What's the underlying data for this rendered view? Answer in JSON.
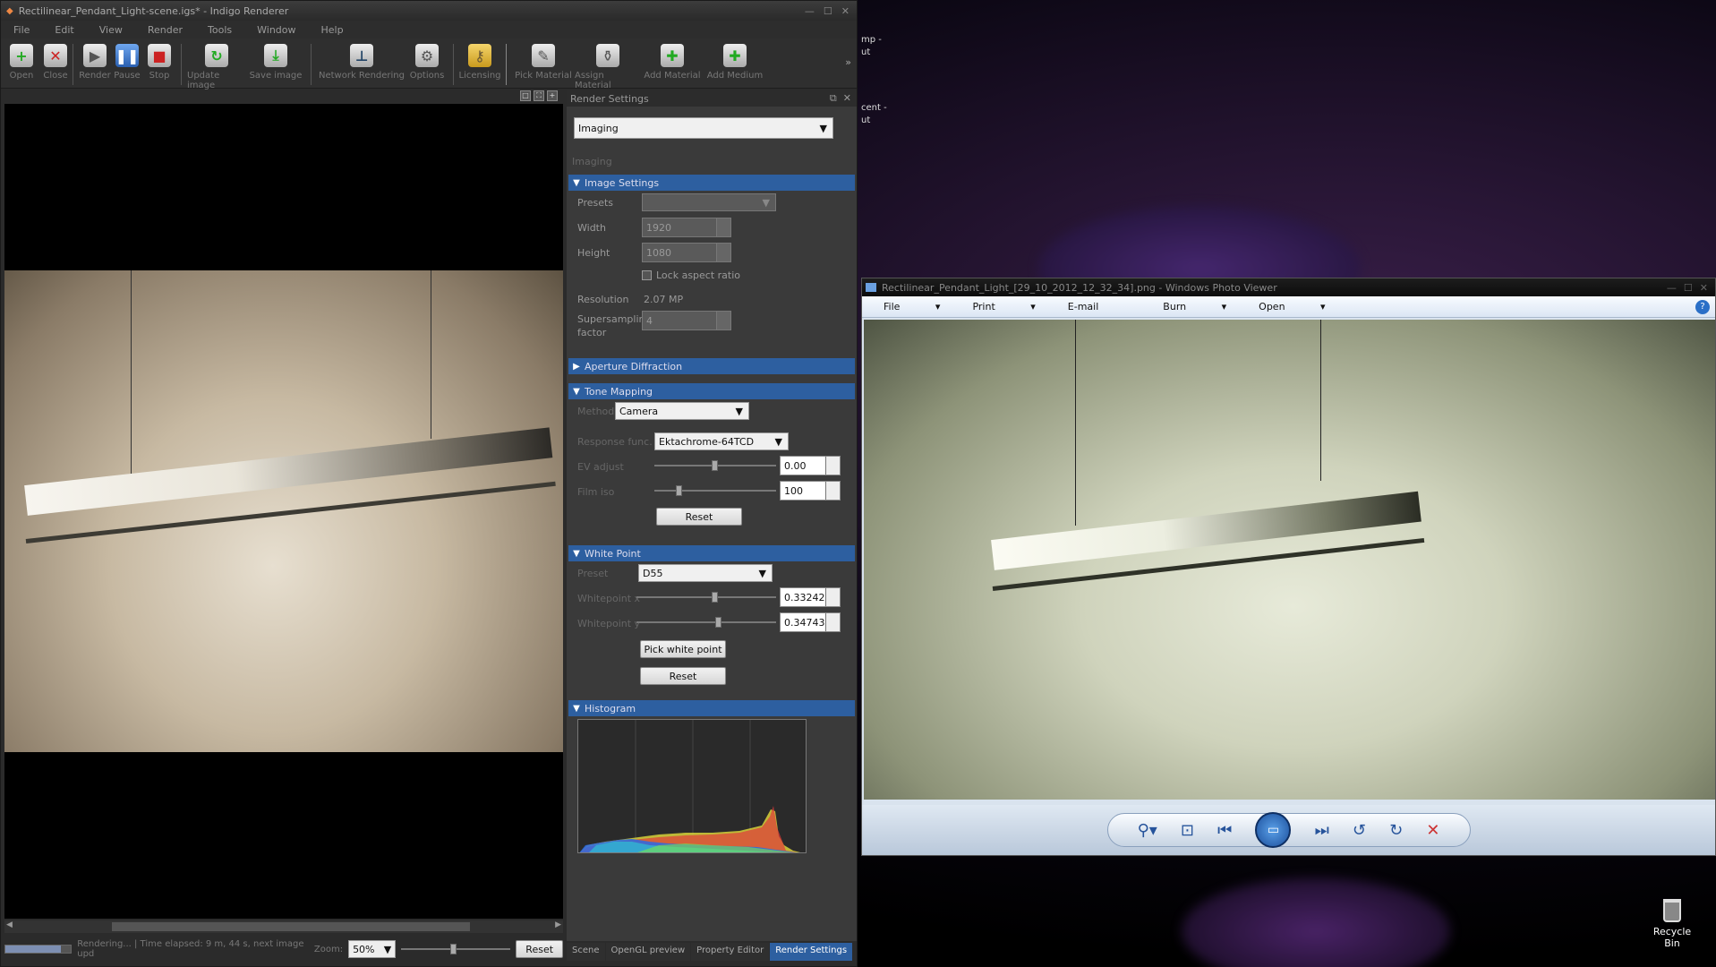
{
  "indigo": {
    "title": "Rectilinear_Pendant_Light-scene.igs* - Indigo Renderer",
    "menu": [
      "File",
      "Edit",
      "View",
      "Render",
      "Tools",
      "Window",
      "Help"
    ],
    "toolbar": [
      {
        "label": "Open",
        "icon": "plus-icon"
      },
      {
        "label": "Close",
        "icon": "close-icon"
      },
      {
        "label": "Render",
        "icon": "play-icon"
      },
      {
        "label": "Pause",
        "icon": "pause-icon"
      },
      {
        "label": "Stop",
        "icon": "stop-icon"
      },
      {
        "label": "Update image",
        "icon": "refresh-icon"
      },
      {
        "label": "Save image",
        "icon": "save-icon"
      },
      {
        "label": "Network Rendering",
        "icon": "network-icon"
      },
      {
        "label": "Options",
        "icon": "gear-icon"
      },
      {
        "label": "Licensing",
        "icon": "key-icon"
      },
      {
        "label": "Pick Material",
        "icon": "eyedropper-icon"
      },
      {
        "label": "Assign Material",
        "icon": "bucket-icon"
      },
      {
        "label": "Add Material",
        "icon": "add-material-icon"
      },
      {
        "label": "Add Medium",
        "icon": "add-medium-icon"
      }
    ],
    "status": {
      "text": "Rendering... | Time elapsed: 9 m, 44 s, next image upd",
      "zoom_label": "Zoom:",
      "zoom": "50%",
      "reset": "Reset",
      "progress": 0.85
    },
    "bottom_tabs": [
      "Scene",
      "OpenGL preview",
      "Property Editor",
      "Render Settings"
    ]
  },
  "render_settings": {
    "title": "Render Settings",
    "category": "Imaging",
    "category_heading": "Imaging",
    "image_settings": {
      "header": "Image Settings",
      "presets_label": "Presets",
      "presets_value": "",
      "width_label": "Width",
      "width": "1920",
      "height_label": "Height",
      "height": "1080",
      "lock_aspect": "Lock aspect ratio",
      "resolution_label": "Resolution",
      "resolution": "2.07 MP",
      "supersampling_label": "Supersampling factor",
      "supersampling": "4"
    },
    "aperture_header": "Aperture Diffraction",
    "tone_mapping": {
      "header": "Tone Mapping",
      "method_label": "Method",
      "method": "Camera",
      "response_label": "Response func.",
      "response": "Ektachrome-64TCD",
      "ev_label": "EV adjust",
      "ev": "0.00",
      "film_label": "Film iso",
      "film": "100",
      "reset": "Reset"
    },
    "white_point": {
      "header": "White Point",
      "preset_label": "Preset",
      "preset": "D55",
      "x_label": "Whitepoint x",
      "x": "0.33242",
      "y_label": "Whitepoint y",
      "y": "0.34743",
      "pick": "Pick white point",
      "reset": "Reset"
    },
    "histogram_header": "Histogram"
  },
  "photo_viewer": {
    "title": "Rectilinear_Pendant_Light_[29_10_2012_12_32_34].png - Windows Photo Viewer",
    "menu": [
      "File",
      "Print",
      "E-mail",
      "Burn",
      "Open"
    ]
  },
  "desktop": {
    "recycle_bin": "Recycle Bin",
    "edge_text_1": "mp -",
    "edge_text_2": "ut",
    "edge_text_3": "cent -",
    "edge_text_4": "ut"
  }
}
